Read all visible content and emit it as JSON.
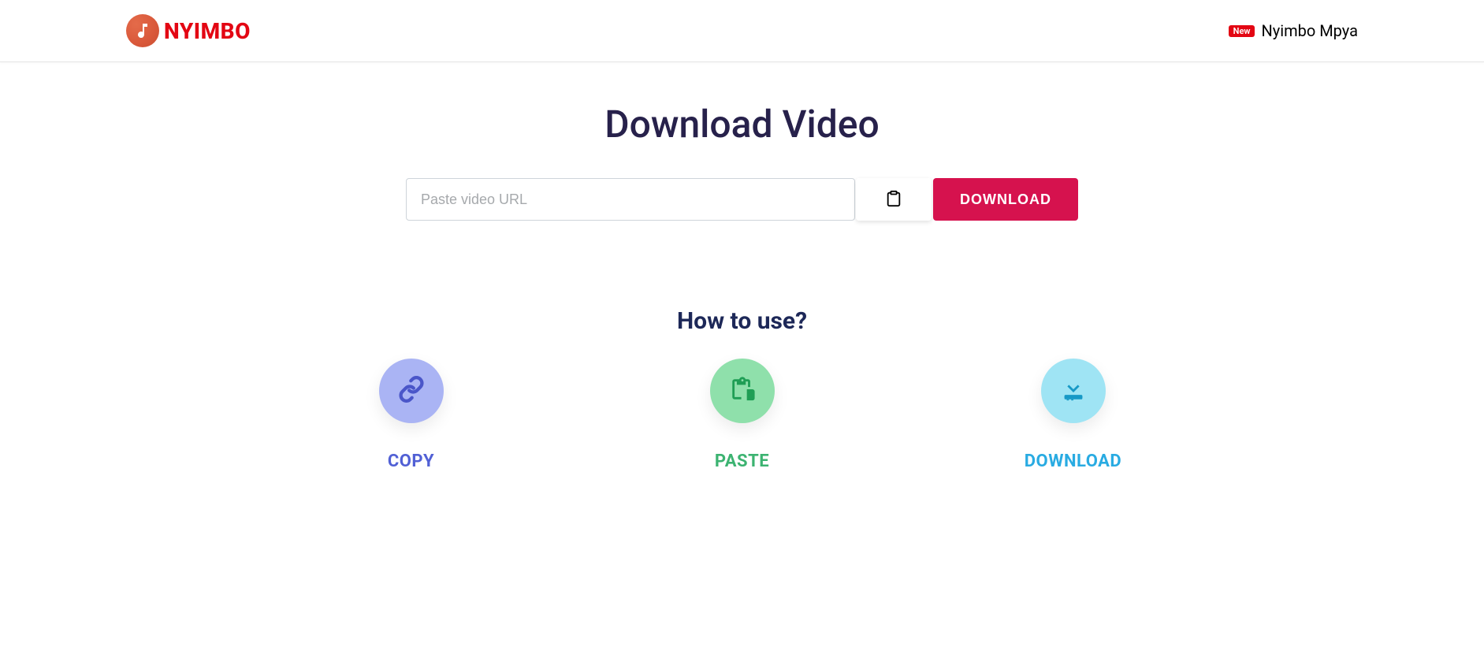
{
  "header": {
    "logo_text": "NYIMBO",
    "badge": "New",
    "nav_link": "Nyimbo Mpya"
  },
  "main": {
    "title": "Download Video",
    "url_placeholder": "Paste video URL",
    "download_button": "DOWNLOAD"
  },
  "how": {
    "title": "How to use?",
    "steps": [
      {
        "label": "COPY"
      },
      {
        "label": "PASTE"
      },
      {
        "label": "DOWNLOAD"
      }
    ]
  }
}
